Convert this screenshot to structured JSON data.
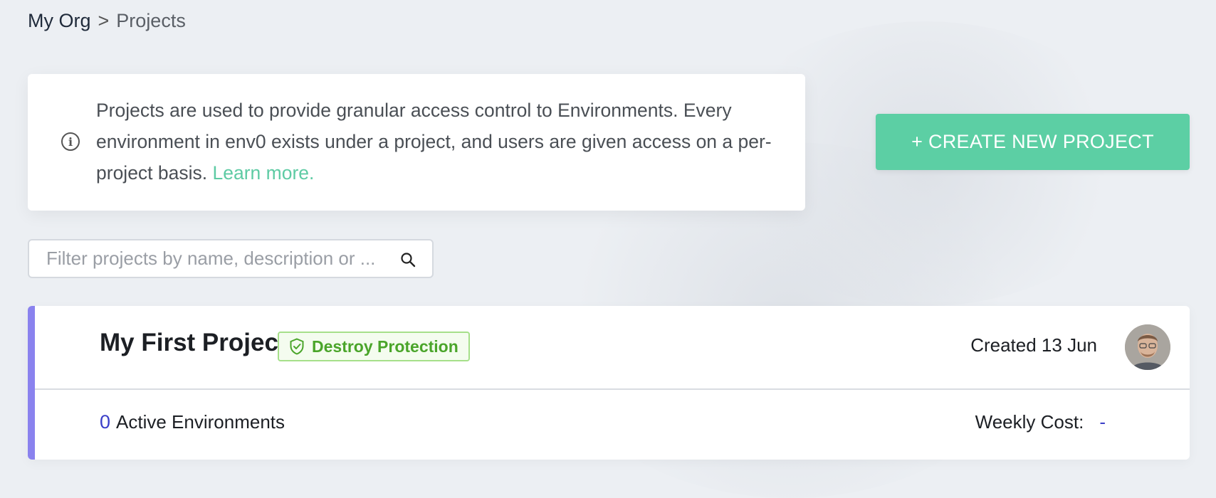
{
  "breadcrumb": {
    "org": "My Org",
    "separator": ">",
    "current": "Projects"
  },
  "info": {
    "text": "Projects are used to provide granular access control to Environments. Every environment in env0 exists under a project, and users are given access on a per-project basis.",
    "link_label": "Learn more."
  },
  "actions": {
    "create_label": "+ CREATE NEW PROJECT"
  },
  "search": {
    "placeholder": "Filter projects by name, description or ...",
    "value": ""
  },
  "project": {
    "name": "My First Project",
    "badge": "Destroy Protection",
    "created": "Created 13 Jun",
    "active_count": "0",
    "active_label": "Active Environments",
    "weekly_cost_label": "Weekly Cost:",
    "weekly_cost_value": "-"
  },
  "colors": {
    "accent": "#5ccfa4",
    "card_accent": "#8a82ee",
    "badge": "#4aa52a",
    "link": "#3b3fc9"
  },
  "icons": {
    "info": "info-icon",
    "search": "search-icon",
    "shield": "shield-check-icon",
    "avatar": "avatar"
  }
}
